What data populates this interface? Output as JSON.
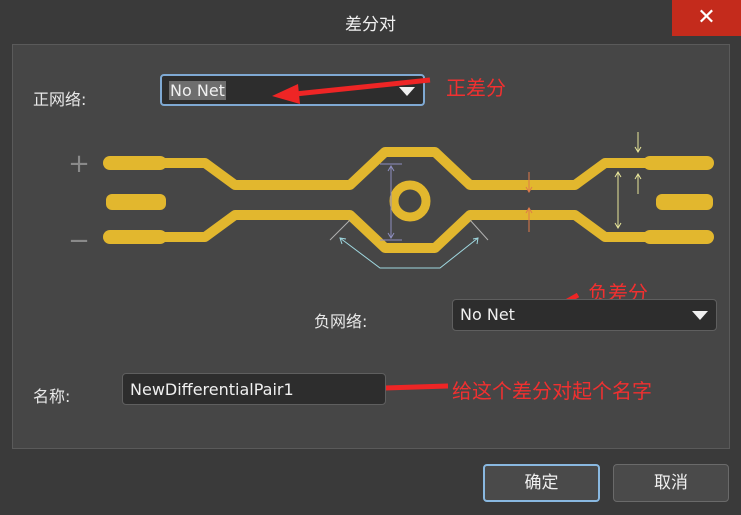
{
  "window": {
    "title": "差分对",
    "close_glyph": "✕"
  },
  "positive_net": {
    "label": "正网络:",
    "value": "No Net"
  },
  "negative_net": {
    "label": "负网络:",
    "value": "No Net"
  },
  "name": {
    "label": "名称:",
    "value": "NewDifferentialPair1"
  },
  "diagram": {
    "plus_sign": "+",
    "minus_sign": "−"
  },
  "annotations": {
    "positive": "正差分",
    "negative": "负差分",
    "name_hint": "给这个差分对起个名字"
  },
  "buttons": {
    "ok": "确定",
    "cancel": "取消"
  },
  "colors": {
    "trace": "#e2b72e",
    "arrow_red": "#ee2525",
    "close_red": "#c42b1c"
  }
}
